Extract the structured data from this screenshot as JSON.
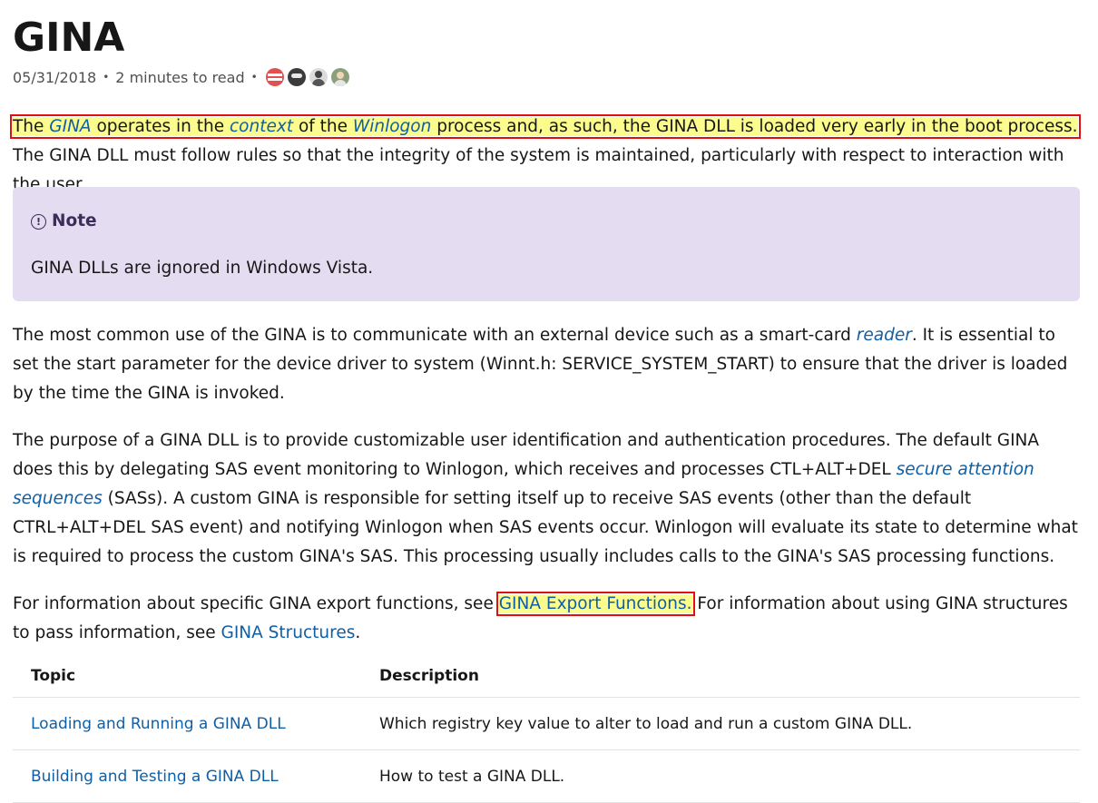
{
  "article": {
    "title": "GINA",
    "date": "05/31/2018",
    "sep1": "•",
    "read_time": "2 minutes to read",
    "sep2": "•"
  },
  "contributors": [
    "contributor-avatar-1",
    "contributor-avatar-2",
    "contributor-avatar-3",
    "contributor-avatar-4"
  ],
  "p1": {
    "t1": "The ",
    "link_gina": "GINA",
    "t2": " operates in the ",
    "link_context": "context",
    "t3": " of the ",
    "link_winlogon": "Winlogon",
    "t4": " process and, as such, the GINA DLL is loaded very early in the boot process.",
    "t5": " The GINA DLL must follow rules so that the integrity of the system is maintained, particularly with respect to interaction with the user."
  },
  "note": {
    "icon": "info-icon",
    "title": "Note",
    "body": "GINA DLLs are ignored in Windows Vista."
  },
  "p2": {
    "t1": "The most common use of the GINA is to communicate with an external device such as a smart-card ",
    "link_reader": "reader",
    "t2": ". It is essential to set the start parameter for the device driver to system (Winnt.h: SERVICE_SYSTEM_START) to ensure that the driver is loaded by the time the GINA is invoked."
  },
  "p3": {
    "t1": "The purpose of a GINA DLL is to provide customizable user identification and authentication procedures. The default GINA does this by delegating SAS event monitoring to Winlogon, which receives and processes CTL+ALT+DEL ",
    "link_sas": "secure attention sequences",
    "t2": " (SASs). A custom GINA is responsible for setting itself up to receive SAS events (other than the default CTRL+ALT+DEL SAS event) and notifying Winlogon when SAS events occur. Winlogon will evaluate its state to determine what is required to process the custom GINA's SAS. This processing usually includes calls to the GINA's SAS processing functions."
  },
  "p4": {
    "t1": "For information about specific GINA export functions, see ",
    "link_export": "GINA Export Functions.",
    "t2": " For information about using GINA structures to pass information, see ",
    "link_structures": "GINA Structures",
    "t3": "."
  },
  "table": {
    "headers": [
      "Topic",
      "Description"
    ],
    "rows": [
      {
        "topic": "Loading and Running a GINA DLL",
        "description": "Which registry key value to alter to load and run a custom GINA DLL."
      },
      {
        "topic": "Building and Testing a GINA DLL",
        "description": "How to test a GINA DLL."
      }
    ]
  },
  "colors": {
    "link": "#0f5fa6",
    "highlight": "#fbfb8e",
    "highlight_border": "#e01010",
    "note_background": "#e4dcf1"
  }
}
